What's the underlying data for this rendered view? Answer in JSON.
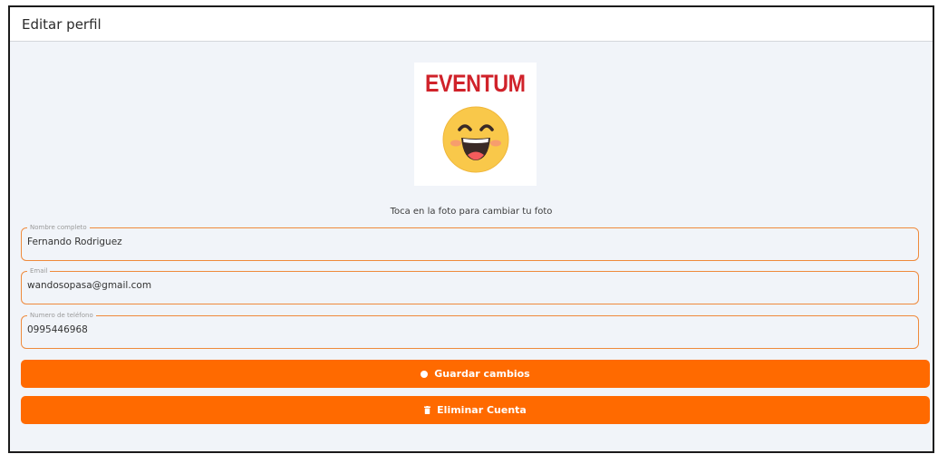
{
  "header": {
    "title": "Editar perfil"
  },
  "profile": {
    "logo_text": "EVENTUM",
    "hint": "Toca en la foto para cambiar tu foto"
  },
  "fields": {
    "name": {
      "label": "Nombre completo",
      "value": "Fernando Rodriguez"
    },
    "email": {
      "label": "Email",
      "value": "wandosopasa@gmail.com"
    },
    "phone": {
      "label": "Numero de teléfono",
      "value": "0995446968"
    }
  },
  "buttons": {
    "save": {
      "label": "Guardar cambios",
      "icon": "check-circle-icon"
    },
    "delete": {
      "label": "Eliminar Cuenta",
      "icon": "trash-icon"
    }
  },
  "colors": {
    "accent": "#ff6a00",
    "field_border": "#ef8a3c",
    "logo_red": "#d0222a",
    "background": "#f1f4f9"
  }
}
